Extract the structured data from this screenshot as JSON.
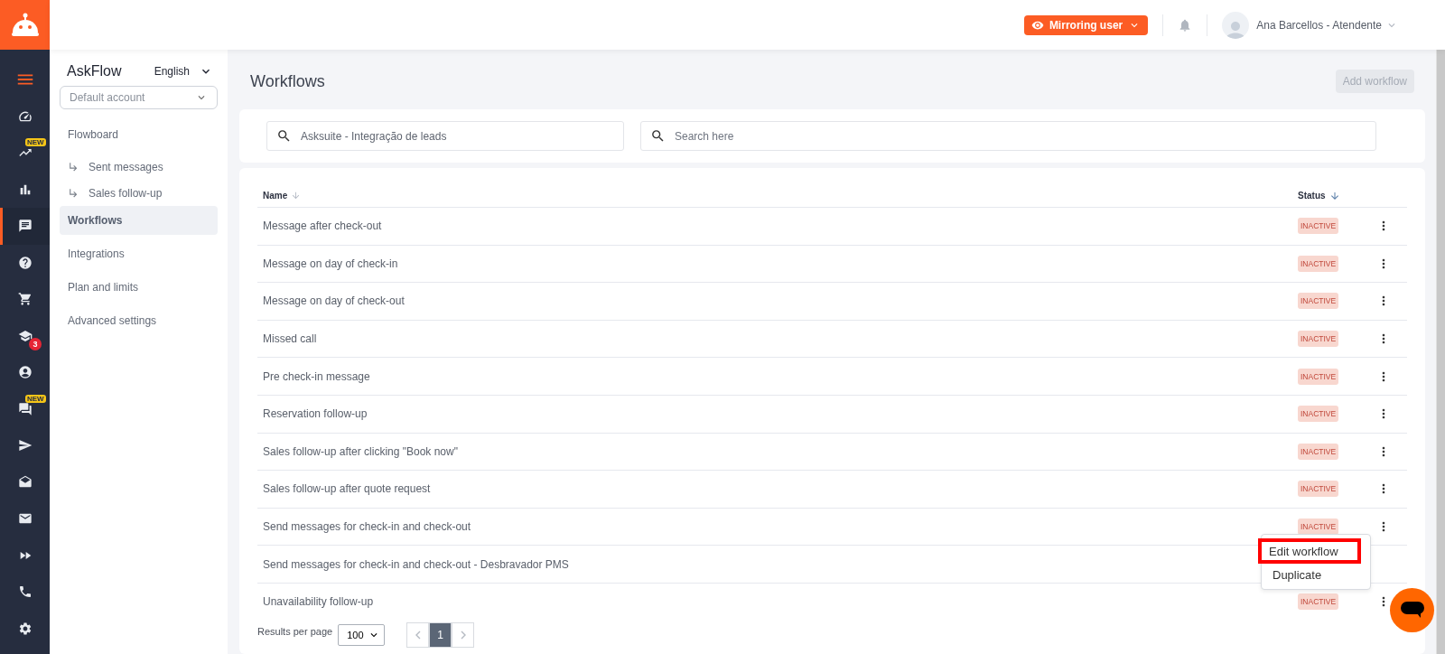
{
  "header": {
    "mirror_button": "Mirroring user",
    "user_name": "Ana Barcellos - Atendente"
  },
  "rail": [
    {
      "selected": false,
      "accent": true
    },
    {
      "selected": false
    },
    {
      "selected": false,
      "badge": "NEW",
      "kind": "new"
    },
    {
      "selected": false
    },
    {
      "selected": true
    },
    {
      "selected": false
    },
    {
      "selected": false
    },
    {
      "selected": false,
      "badge": "3",
      "kind": "count"
    },
    {
      "selected": false
    },
    {
      "selected": false,
      "badge": "NEW",
      "kind": "new"
    },
    {
      "selected": false
    },
    {
      "selected": false
    },
    {
      "selected": false
    },
    {
      "selected": false
    },
    {
      "selected": false
    },
    {
      "selected": false
    }
  ],
  "sidebar": {
    "title": "AskFlow",
    "language": "English",
    "account_placeholder": "Default account",
    "items": [
      {
        "label": "Flowboard",
        "selected": false,
        "children": [
          {
            "label": "Sent messages",
            "selected": false
          },
          {
            "label": "Sales follow-up",
            "selected": false
          }
        ]
      },
      {
        "label": "Workflows",
        "selected": true
      },
      {
        "label": "Integrations",
        "selected": false
      },
      {
        "label": "Plan and limits",
        "selected": false
      },
      {
        "label": "Advanced settings",
        "selected": false
      }
    ]
  },
  "page_title": "Workflows",
  "add_button": {
    "label": "Add workflow",
    "disabled": true
  },
  "filters": [
    {
      "value": "Asksuite - Integração de leads"
    },
    {
      "placeholder": "Search here"
    }
  ],
  "table": {
    "columns": [
      "Name",
      "Status"
    ],
    "rows": [
      {
        "name": "Message after check-out",
        "status": "INACTIVE"
      },
      {
        "name": "Message on day of check-in",
        "status": "INACTIVE"
      },
      {
        "name": "Message on day of check-out",
        "status": "INACTIVE"
      },
      {
        "name": "Missed call",
        "status": "INACTIVE"
      },
      {
        "name": "Pre check-in message",
        "status": "INACTIVE"
      },
      {
        "name": "Reservation follow-up",
        "status": "INACTIVE"
      },
      {
        "name": "Sales follow-up after clicking \"Book now\"",
        "status": "INACTIVE"
      },
      {
        "name": "Sales follow-up after quote request",
        "status": "INACTIVE"
      },
      {
        "name": "Send messages for check-in and check-out",
        "status": "INACTIVE"
      },
      {
        "name": "Send messages for check-in and check-out - Desbravador PMS"
      },
      {
        "name": "Unavailability follow-up",
        "status": "INACTIVE"
      }
    ]
  },
  "row_menu": {
    "items": [
      {
        "label": "Edit workflow",
        "highlighted": true
      },
      {
        "label": "Duplicate",
        "highlighted": false
      }
    ]
  },
  "pagination": {
    "label": "Results per page",
    "per_page": "100",
    "pages": [
      {
        "label": "1",
        "selected": true
      }
    ]
  }
}
